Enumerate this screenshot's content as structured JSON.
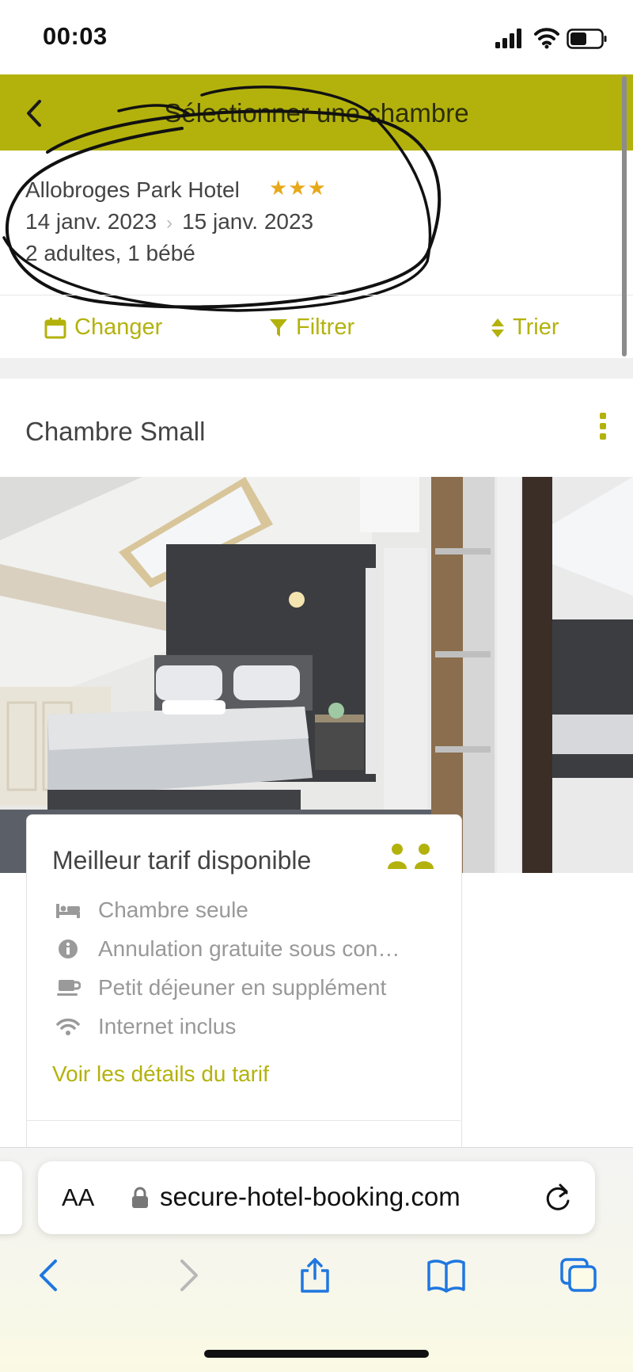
{
  "status_bar": {
    "time": "00:03"
  },
  "header": {
    "title": "Sélectionner une chambre"
  },
  "hotel": {
    "name": "Allobroges Park Hotel",
    "stars": "★★★",
    "date_from": "14 janv. 2023",
    "date_to": "15 janv. 2023",
    "guests": "2 adultes, 1 bébé"
  },
  "actions": {
    "change": "Changer",
    "filter": "Filtrer",
    "sort": "Trier"
  },
  "room": {
    "title": "Chambre Small"
  },
  "rate_card": {
    "title": "Meilleur tarif disponible",
    "features": [
      {
        "icon": "bed-icon",
        "label": "Chambre seule"
      },
      {
        "icon": "info-icon",
        "label": "Annulation gratuite sous con…"
      },
      {
        "icon": "coffee-icon",
        "label": "Petit déjeuner en supplément"
      },
      {
        "icon": "wifi-icon",
        "label": "Internet inclus"
      }
    ],
    "details_link": "Voir les détails du tarif"
  },
  "browser": {
    "aa": "AA",
    "url": "secure-hotel-booking.com"
  },
  "colors": {
    "accent": "#b3b20d",
    "star": "#e7a91a"
  }
}
